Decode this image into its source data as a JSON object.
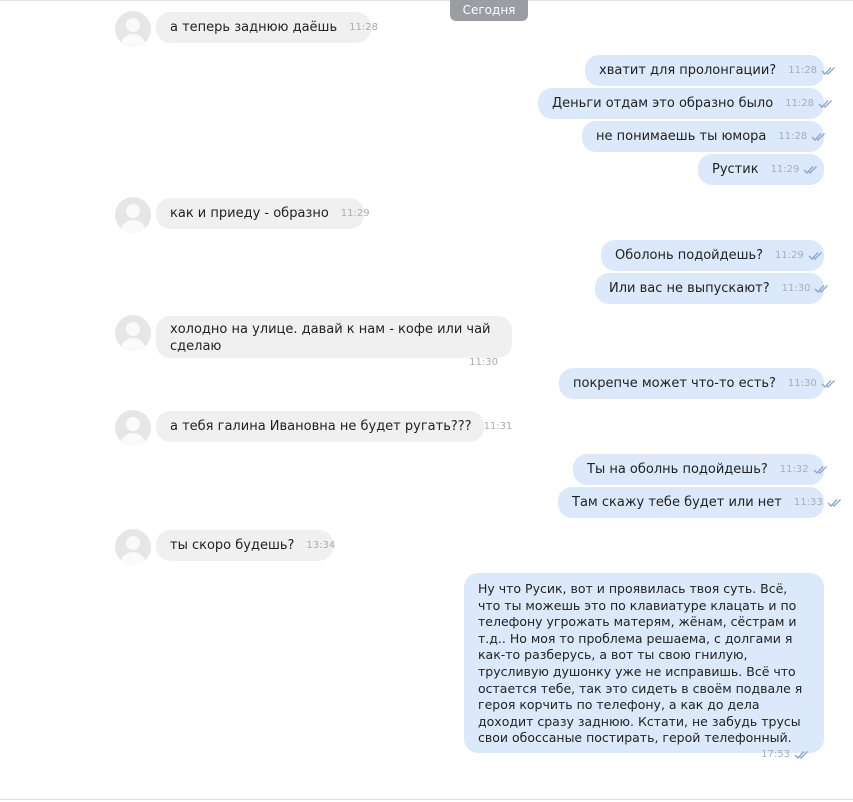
{
  "date_separator": "Сегодня",
  "messages": [
    {
      "dir": "in",
      "text": "а теперь заднюю даёшь",
      "time": "11:28"
    },
    {
      "dir": "out",
      "text": "хватит для пролонгации?",
      "time": "11:28"
    },
    {
      "dir": "out",
      "text": "Деньги отдам это образно было",
      "time": "11:28"
    },
    {
      "dir": "out",
      "text": "не понимаешь ты юмора",
      "time": "11:28"
    },
    {
      "dir": "out",
      "text": "Рустик",
      "time": "11:29"
    },
    {
      "dir": "in",
      "text": "как и приеду - образно",
      "time": "11:29"
    },
    {
      "dir": "out",
      "text": "Оболонь подойдешь?",
      "time": "11:29"
    },
    {
      "dir": "out",
      "text": "Или вас не выпускают?",
      "time": "11:30"
    },
    {
      "dir": "in",
      "text": "холодно на улице. давай к нам - кофе или чай сделаю",
      "time": "11:30"
    },
    {
      "dir": "out",
      "text": "покрепче может что-то есть?",
      "time": "11:30"
    },
    {
      "dir": "in",
      "text": "а тебя галина Ивановна не будет ругать???",
      "time": "11:31"
    },
    {
      "dir": "out",
      "text": "Ты на оболнь подойдешь?",
      "time": "11:32"
    },
    {
      "dir": "out",
      "text": "Там скажу тебе будет или нет",
      "time": "11:33"
    },
    {
      "dir": "in",
      "text": "ты скоро будешь?",
      "time": "13:34"
    },
    {
      "dir": "out",
      "text": "Ну что Русик, вот и проявилась твоя суть. Всё, что ты можешь это по клавиатуре клацать и по телефону угрожать матерям, жёнам, сёстрам и т.д.. Но моя то проблема решаема, с долгами я как-то разберусь, а вот ты свою гнилую, трусливую душонку уже не исправишь. Всё что остается тебе, так это сидеть в своём подвале я героя корчить по телефону, а как до дела доходит сразу заднюю. Кстати, не забудь трусы свои обоссаные постирать, герой телефонный.",
      "time": "17:53"
    }
  ]
}
